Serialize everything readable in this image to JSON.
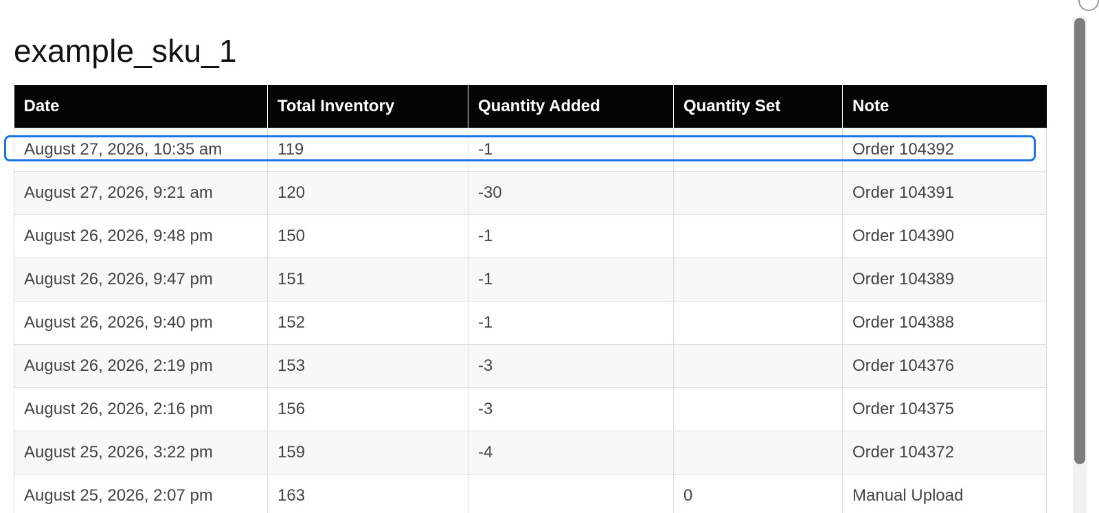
{
  "page": {
    "title": "example_sku_1"
  },
  "table": {
    "columns": [
      "Date",
      "Total Inventory",
      "Quantity Added",
      "Quantity Set",
      "Note"
    ],
    "rows": [
      [
        "August 27, 2026, 10:35 am",
        "119",
        "-1",
        "",
        "Order 104392"
      ],
      [
        "August 27, 2026, 9:21 am",
        "120",
        "-30",
        "",
        "Order 104391"
      ],
      [
        "August 26, 2026, 9:48 pm",
        "150",
        "-1",
        "",
        "Order 104390"
      ],
      [
        "August 26, 2026, 9:47 pm",
        "151",
        "-1",
        "",
        "Order 104389"
      ],
      [
        "August 26, 2026, 9:40 pm",
        "152",
        "-1",
        "",
        "Order 104388"
      ],
      [
        "August 26, 2026, 2:19 pm",
        "153",
        "-3",
        "",
        "Order 104376"
      ],
      [
        "August 26, 2026, 2:16 pm",
        "156",
        "-3",
        "",
        "Order 104375"
      ],
      [
        "August 25, 2026, 3:22 pm",
        "159",
        "-4",
        "",
        "Order 104372"
      ],
      [
        "August 25, 2026, 2:07 pm",
        "163",
        "",
        "0",
        "Manual Upload"
      ]
    ],
    "highlighted_row": 0,
    "colors": {
      "header_bg": "#050505",
      "highlight": "#1a73e8"
    }
  }
}
